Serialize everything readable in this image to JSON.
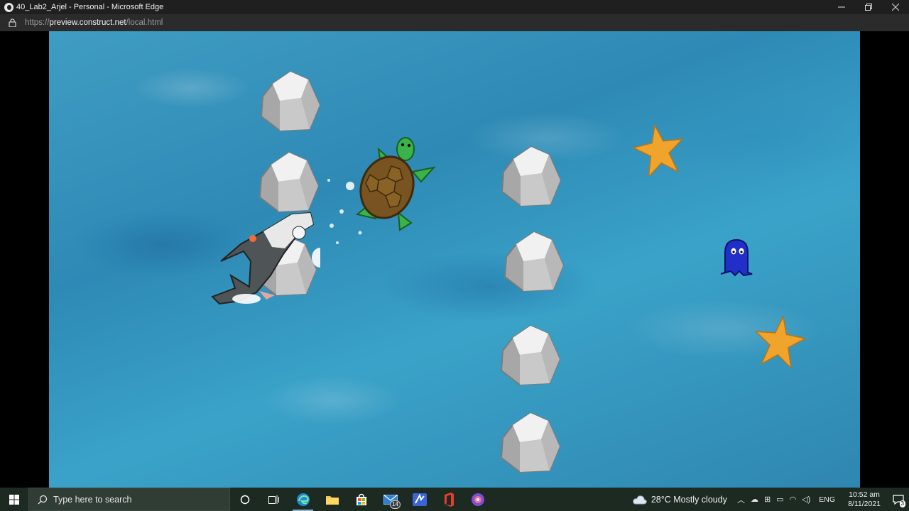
{
  "window": {
    "title": "40_Lab2_Arjel - Personal - Microsoft Edge",
    "controls": {
      "minimize": "—",
      "maximize": "❐",
      "close": "✕"
    }
  },
  "address": {
    "scheme": "https://",
    "host": "preview.construct.net",
    "path": "/local.html"
  },
  "game": {
    "background": "ocean-water",
    "sprites": [
      "rock",
      "rock",
      "rock",
      "rock",
      "rock",
      "rock",
      "rock",
      "shark",
      "turtle",
      "starfish",
      "starfish",
      "blue-ghost"
    ]
  },
  "taskbar": {
    "search_placeholder": "Type here to search",
    "apps": [
      "cortana",
      "task-view",
      "edge",
      "file-explorer",
      "store",
      "mail",
      "app-blue",
      "office",
      "app-purple"
    ],
    "mail_badge": "14",
    "weather": "28°C  Mostly cloudy",
    "language": "ENG",
    "time": "10:52 am",
    "date": "8/11/2021",
    "notification_count": "3"
  },
  "colors": {
    "accent": "#8ab4d8",
    "water": "#2e8ab5",
    "taskbar": "#1c2a22"
  }
}
